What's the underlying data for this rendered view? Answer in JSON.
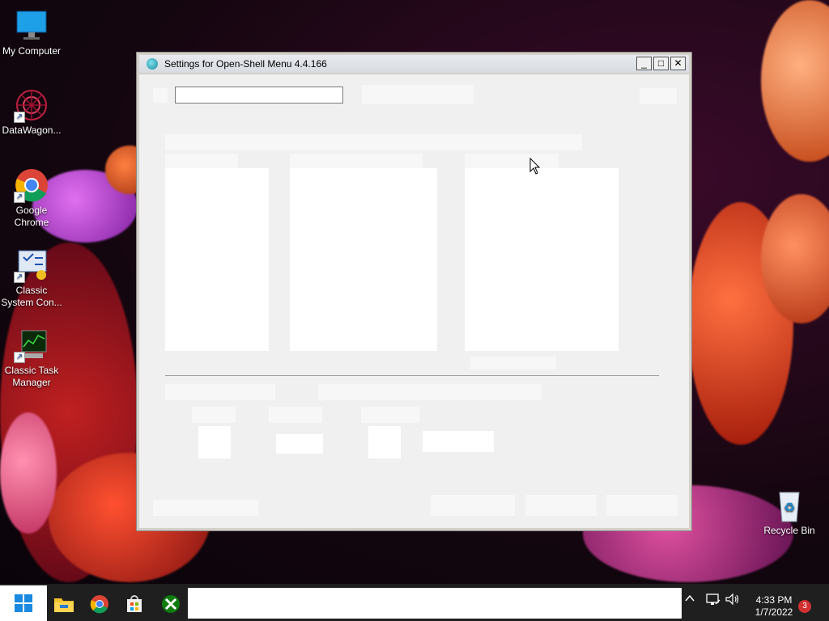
{
  "desktop": {
    "icons": [
      {
        "label": "My Computer"
      },
      {
        "label": "DataWagon..."
      },
      {
        "label": "Google Chrome"
      },
      {
        "label": "Classic System Con..."
      },
      {
        "label": "Classic Task Manager"
      },
      {
        "label": "Recycle Bin"
      }
    ]
  },
  "window": {
    "title": "Settings for Open-Shell Menu 4.4.166",
    "minimize_glyph": "_",
    "maximize_glyph": "□",
    "close_glyph": "✕",
    "search": {
      "value": "",
      "placeholder": ""
    }
  },
  "taskbar": {
    "pinned": [
      "start-icon",
      "file-explorer-icon",
      "chrome-icon",
      "store-icon",
      "xbox-icon"
    ],
    "time": "4:33 PM",
    "date": "1/7/2022",
    "notification_count": "3"
  },
  "colors": {
    "window_bg": "#f0f0f0",
    "taskbar_bg": "#1f1f1f",
    "title_bar": "#dde0e5"
  }
}
